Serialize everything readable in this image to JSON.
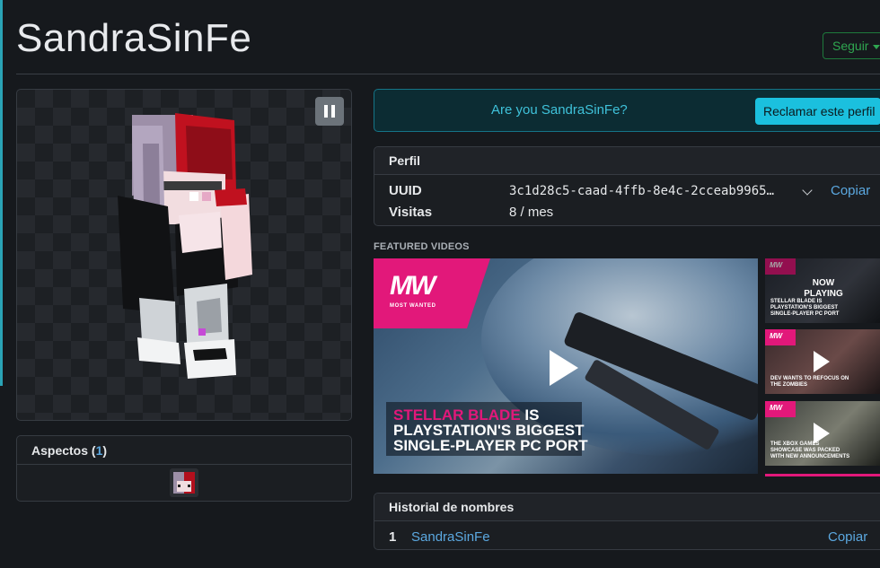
{
  "header": {
    "title": "SandraSinFe",
    "follow_label": "Seguir"
  },
  "aspects": {
    "label": "Aspectos",
    "count_open": " (",
    "count": "1",
    "count_close": ")"
  },
  "claim": {
    "question": "Are you SandraSinFe?",
    "button_label": "Reclamar este perfil"
  },
  "profile": {
    "title": "Perfil",
    "uuid_label": "UUID",
    "uuid_value": "3c1d28c5-caad-4ffb-8e4c-2cceab9965…",
    "copy_label": "Copiar",
    "visits_label": "Visitas",
    "visits_value": "8 / mes"
  },
  "featured": {
    "label": "FEATURED VIDEOS",
    "main_video": {
      "logo": "MW",
      "logo_sub": "MOST WANTED",
      "headline_pink": "STELLAR BLADE",
      "headline_white_1": " IS",
      "headline_line2": "PLAYSTATION'S BIGGEST",
      "headline_line3": "SINGLE-PLAYER PC PORT"
    },
    "thumbnails": [
      {
        "logo": "MW",
        "overlay": "NOW PLAYING",
        "caption": "STELLAR BLADE IS PLAYSTATION'S BIGGEST SINGLE-PLAYER PC PORT"
      },
      {
        "logo": "MW",
        "caption": "DEV WANTS TO REFOCUS ON THE ZOMBIES"
      },
      {
        "logo": "MW",
        "caption": "THE XBOX GAMES SHOWCASE WAS PACKED WITH NEW ANNOUNCEMENTS"
      }
    ]
  },
  "history": {
    "title": "Historial de nombres",
    "entries": [
      {
        "index": "1",
        "name": "SandraSinFe"
      }
    ],
    "copy_label": "Copiar"
  },
  "colors": {
    "background": "#16191d",
    "accent_cyan": "#1bc0de",
    "link_blue": "#5ba8e0",
    "follow_green": "#2fa650",
    "brand_pink": "#e2187a"
  }
}
